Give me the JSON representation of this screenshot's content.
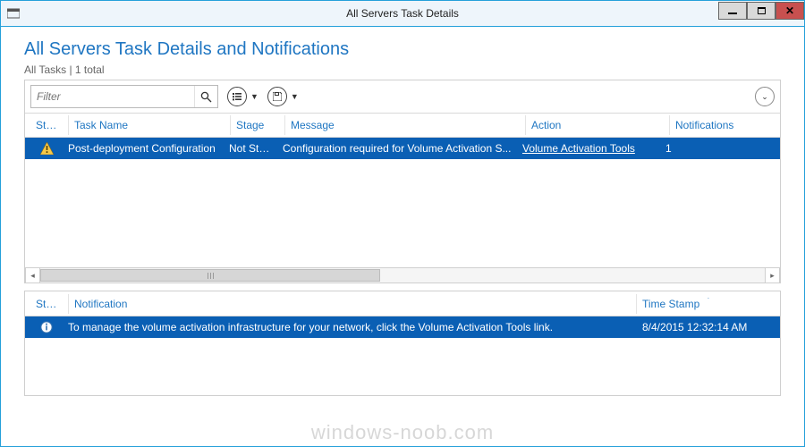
{
  "window": {
    "title": "All Servers Task Details"
  },
  "heading": "All Servers Task Details and Notifications",
  "subheading": "All Tasks | 1 total",
  "filter": {
    "placeholder": "Filter"
  },
  "top_grid": {
    "columns": {
      "status": "Status",
      "task_name": "Task Name",
      "stage": "Stage",
      "message": "Message",
      "action": "Action",
      "notifications": "Notifications"
    },
    "row": {
      "task_name": "Post-deployment Configuration",
      "stage": "Not Sta...",
      "message": "Configuration required for Volume Activation S...",
      "action": "Volume Activation Tools",
      "notifications": "1"
    }
  },
  "bottom_grid": {
    "columns": {
      "status": "Status",
      "notification": "Notification",
      "time_stamp": "Time Stamp"
    },
    "row": {
      "notification": "To manage the volume activation infrastructure for your network, click the Volume Activation Tools link.",
      "time_stamp": "8/4/2015 12:32:14 AM"
    }
  },
  "watermark": "windows-noob.com"
}
